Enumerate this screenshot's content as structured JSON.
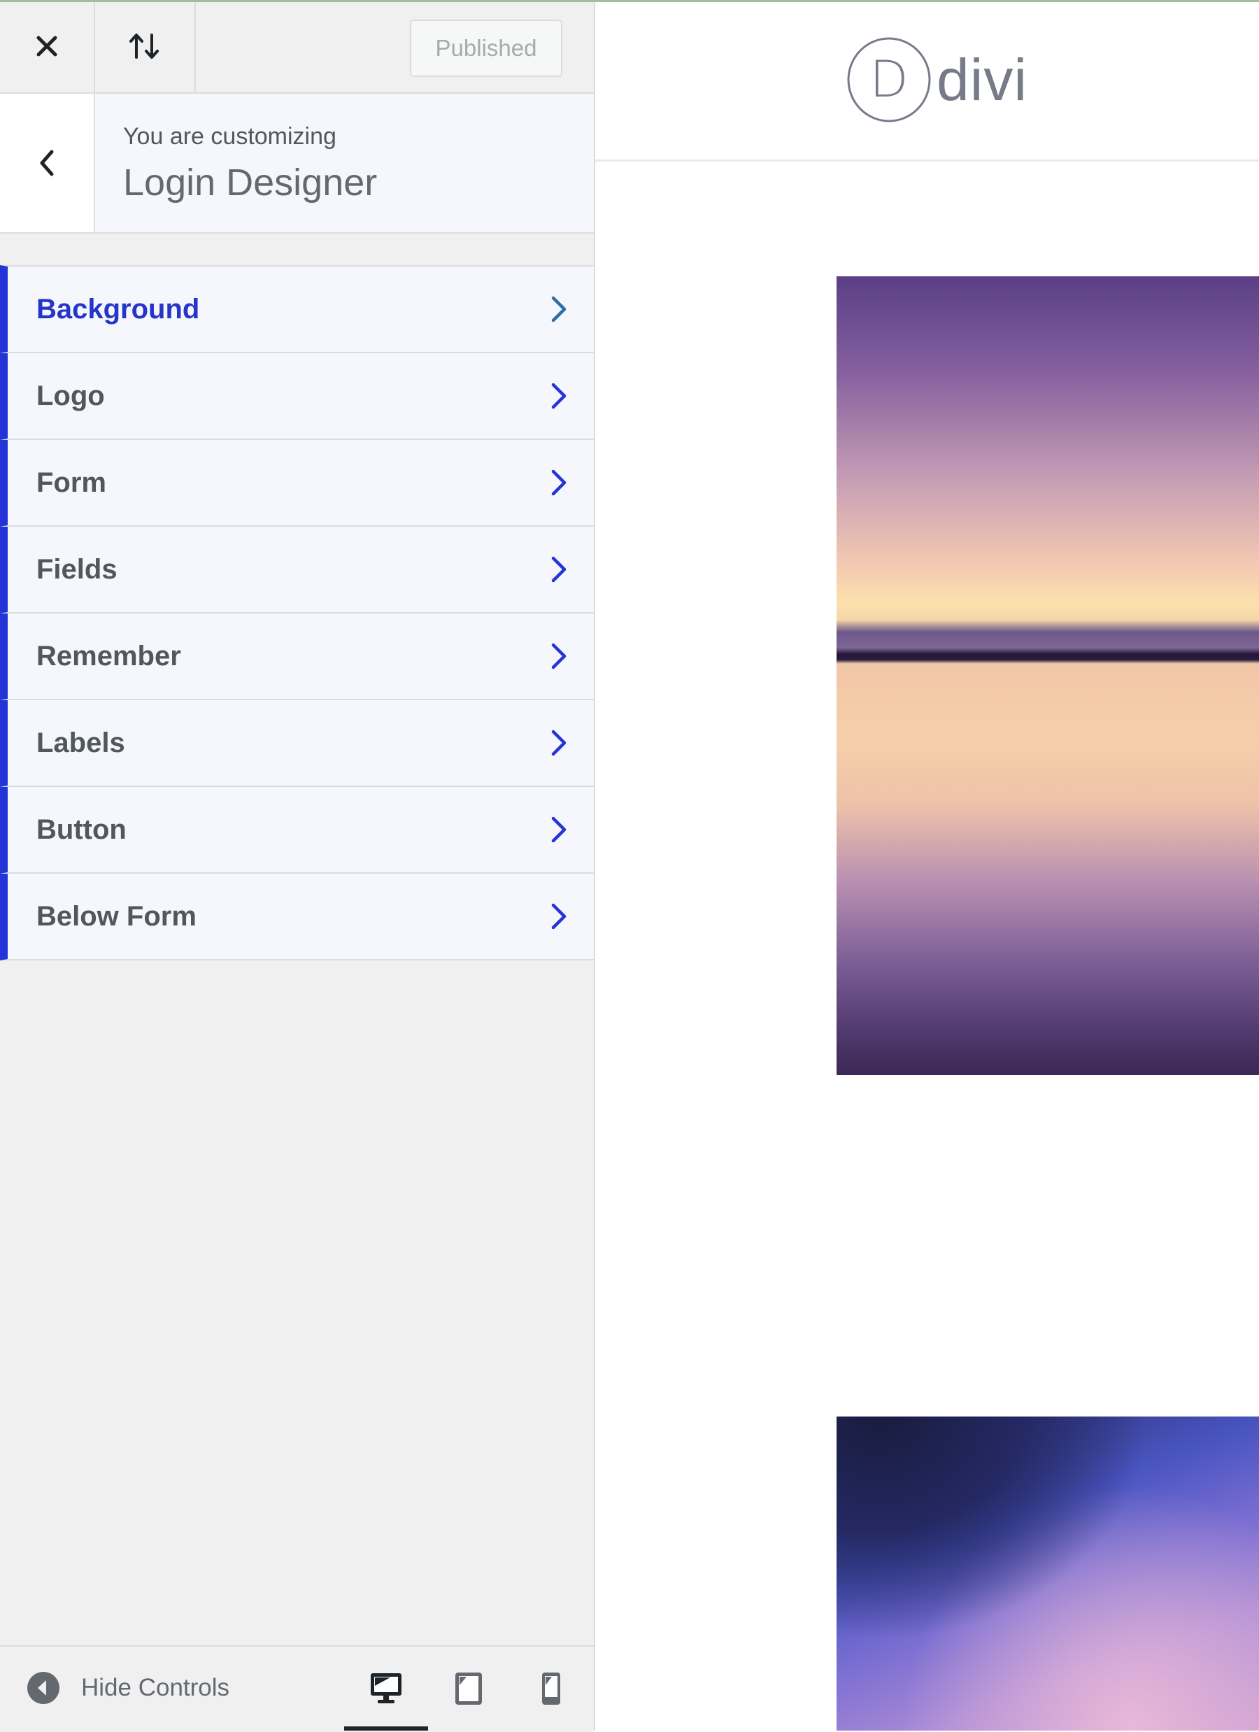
{
  "topbar": {
    "close_icon": "close-icon",
    "sort_icon": "arrows-up-down-icon",
    "publish_label": "Published"
  },
  "header": {
    "back_icon": "chevron-left-icon",
    "customizing_label": "You are customizing",
    "panel_title": "Login Designer"
  },
  "menu": {
    "accent_color": "#2435d8",
    "items": [
      {
        "label": "Background",
        "active": true
      },
      {
        "label": "Logo",
        "active": false
      },
      {
        "label": "Form",
        "active": false
      },
      {
        "label": "Fields",
        "active": false
      },
      {
        "label": "Remember",
        "active": false
      },
      {
        "label": "Labels",
        "active": false
      },
      {
        "label": "Button",
        "active": false
      },
      {
        "label": "Below Form",
        "active": false
      }
    ]
  },
  "footer": {
    "hide_controls_label": "Hide Controls",
    "devices": [
      {
        "name": "desktop",
        "icon": "desktop-icon",
        "active": true
      },
      {
        "name": "tablet",
        "icon": "tablet-icon",
        "active": false
      },
      {
        "name": "mobile",
        "icon": "mobile-icon",
        "active": false
      }
    ]
  },
  "preview": {
    "logo_letter": "D",
    "logo_text": "divi",
    "images": [
      {
        "description": "sunset over calm lake, purple and peach tones"
      },
      {
        "description": "purple and blue cloudy sky at dusk"
      }
    ]
  }
}
